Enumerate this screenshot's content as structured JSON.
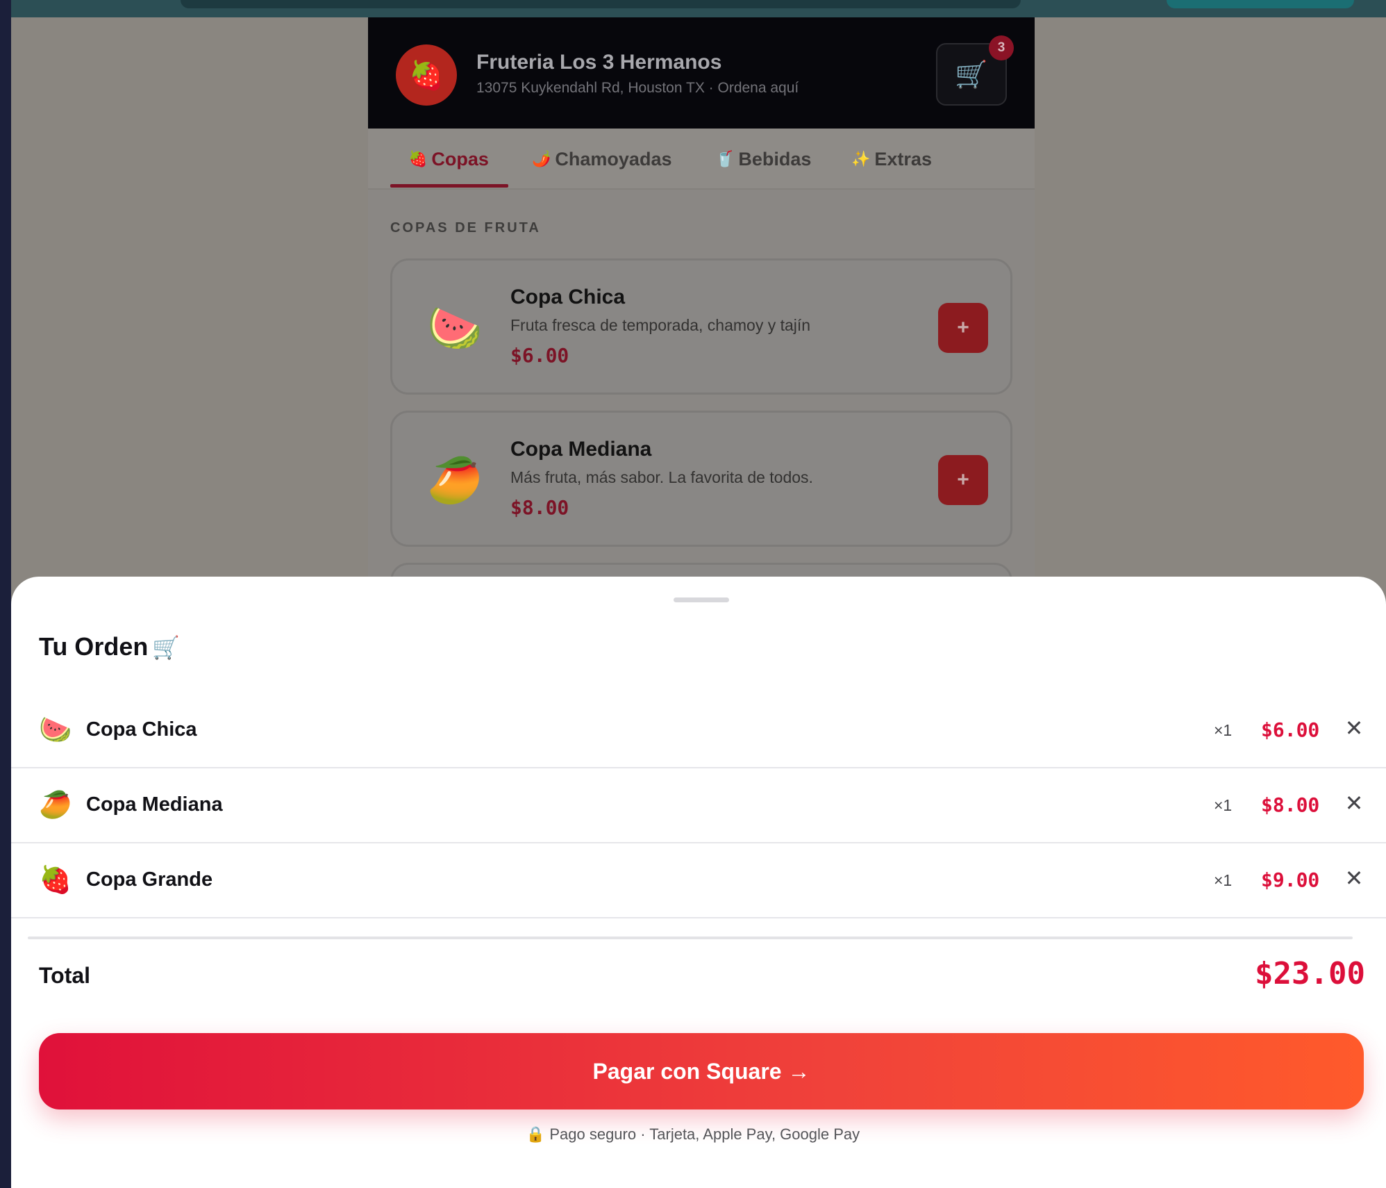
{
  "store": {
    "logo_emoji": "🍓",
    "name": "Fruteria Los 3 Hermanos",
    "subtitle": "13075 Kuykendahl Rd, Houston TX · Ordena aquí",
    "cart_icon": "🛒",
    "cart_count": "3"
  },
  "tabs": [
    {
      "icon": "🍓",
      "label": "Copas",
      "active": true
    },
    {
      "icon": "🌶️",
      "label": "Chamoyadas",
      "active": false
    },
    {
      "icon": "🥤",
      "label": "Bebidas",
      "active": false
    },
    {
      "icon": "✨",
      "label": "Extras",
      "active": false
    }
  ],
  "section_title": "COPAS DE FRUTA",
  "menu_items": [
    {
      "emoji": "🍉",
      "name": "Copa Chica",
      "desc": "Fruta fresca de temporada, chamoy y tajín",
      "price": "$6.00",
      "add": "+"
    },
    {
      "emoji": "🥭",
      "name": "Copa Mediana",
      "desc": "Más fruta, más sabor. La favorita de todos.",
      "price": "$8.00",
      "add": "+"
    }
  ],
  "order": {
    "title": "Tu Orden",
    "title_icon": "🛒",
    "items": [
      {
        "emoji": "🍉",
        "name": "Copa Chica",
        "qty": "×1",
        "price": "$6.00",
        "remove": "✕"
      },
      {
        "emoji": "🥭",
        "name": "Copa Mediana",
        "qty": "×1",
        "price": "$8.00",
        "remove": "✕"
      },
      {
        "emoji": "🍓",
        "name": "Copa Grande",
        "qty": "×1",
        "price": "$9.00",
        "remove": "✕"
      }
    ],
    "total_label": "Total",
    "total_value": "$23.00",
    "pay_label": "Pagar con Square →",
    "secure_note": "🔒 Pago seguro · Tarjeta, Apple Pay, Google Pay"
  },
  "colors": {
    "accent": "#dc0f3a",
    "header_bg": "#07070c",
    "pay_gradient_start": "#e0113a",
    "pay_gradient_end": "#ff5a2b"
  }
}
